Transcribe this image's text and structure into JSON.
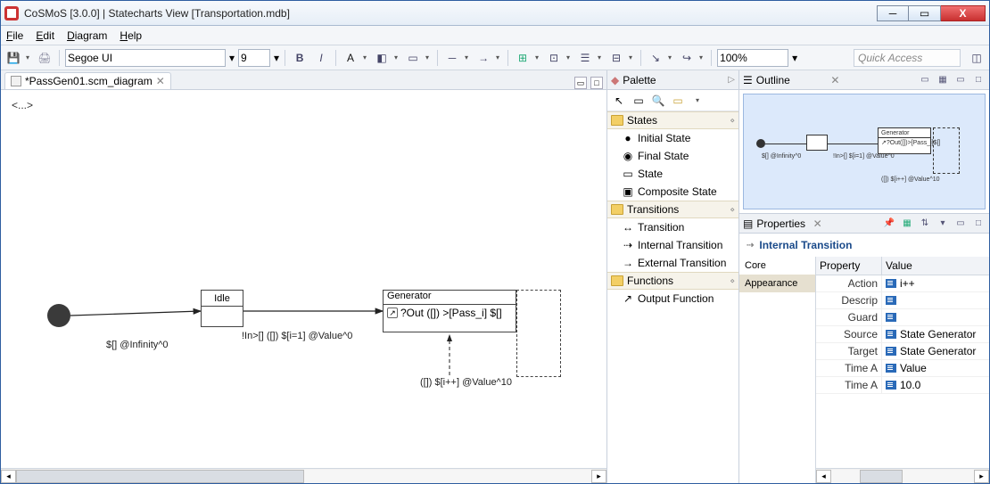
{
  "window": {
    "title": "CoSMoS [3.0.0] | Statecharts View [Transportation.mdb]"
  },
  "menu": {
    "file": "File",
    "edit": "Edit",
    "diagram": "Diagram",
    "help": "Help"
  },
  "toolbar": {
    "font": "Segoe UI",
    "size": "9",
    "zoom": "100%",
    "quick_access_placeholder": "Quick Access"
  },
  "editor": {
    "tab_label": "*PassGen01.scm_diagram",
    "topleft": "<...>",
    "idle_label": "Idle",
    "generator_label": "Generator",
    "generator_row": "?Out ([]) >[Pass_i] $[]",
    "edge1_label": "$[] @Infinity^0",
    "edge2_label": "!In>[] ([]) $[i=1] @Value^0",
    "edge3_label": "([]) $[i++] @Value^10"
  },
  "palette": {
    "title": "Palette",
    "groups": {
      "states": {
        "label": "States",
        "items": [
          "Initial State",
          "Final State",
          "State",
          "Composite State"
        ]
      },
      "transitions": {
        "label": "Transitions",
        "items": [
          "Transition",
          "Internal Transition",
          "External Transition"
        ]
      },
      "functions": {
        "label": "Functions",
        "items": [
          "Output Function"
        ]
      }
    }
  },
  "outline": {
    "title": "Outline"
  },
  "properties": {
    "title": "Properties",
    "heading": "Internal Transition",
    "cats": {
      "core": "Core",
      "appearance": "Appearance"
    },
    "cols": {
      "prop": "Property",
      "val": "Value"
    },
    "rows": [
      {
        "p": "Action",
        "v": "i++"
      },
      {
        "p": "Descrip",
        "v": ""
      },
      {
        "p": "Guard",
        "v": ""
      },
      {
        "p": "Source",
        "v": "State Generator"
      },
      {
        "p": "Target",
        "v": "State Generator"
      },
      {
        "p": "Time A",
        "v": "Value"
      },
      {
        "p": "Time A",
        "v": "10.0"
      }
    ]
  }
}
